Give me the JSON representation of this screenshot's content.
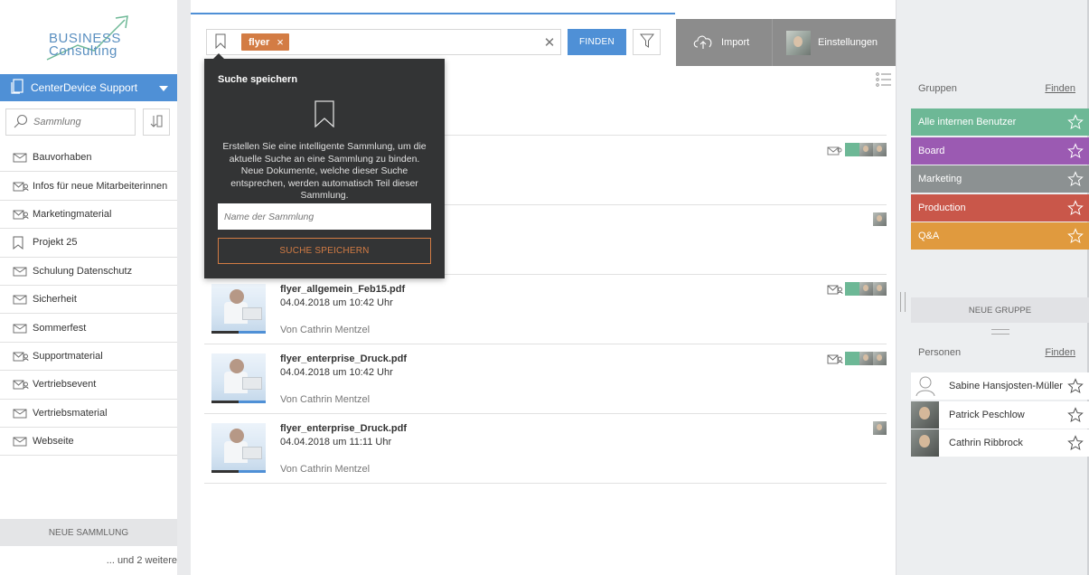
{
  "logo": {
    "line1": "BUSINESS",
    "line2": "Consulting"
  },
  "sidebar": {
    "space_label": "CenterDevice Support",
    "search_placeholder": "Sammlung",
    "items": [
      {
        "label": "Bauvorhaben",
        "icon": "envelope-icon"
      },
      {
        "label": "Infos für neue Mitarbeiterinnen",
        "icon": "shared-envelope-icon"
      },
      {
        "label": "Marketingmaterial",
        "icon": "shared-envelope-icon"
      },
      {
        "label": "Projekt 25",
        "icon": "bookmark-icon"
      },
      {
        "label": "Schulung Datenschutz",
        "icon": "envelope-icon"
      },
      {
        "label": "Sicherheit",
        "icon": "envelope-icon"
      },
      {
        "label": "Sommerfest",
        "icon": "envelope-icon"
      },
      {
        "label": "Supportmaterial",
        "icon": "shared-envelope-icon"
      },
      {
        "label": "Vertriebsevent",
        "icon": "shared-envelope-icon"
      },
      {
        "label": "Vertriebsmaterial",
        "icon": "envelope-icon"
      },
      {
        "label": "Webseite",
        "icon": "envelope-icon"
      }
    ],
    "new_collection": "NEUE SAMMLUNG",
    "more": "... und 2 weitere"
  },
  "search": {
    "tag": "flyer",
    "find_label": "FINDEN"
  },
  "toolbar": {
    "import_label": "Import",
    "settings_label": "Einstellungen"
  },
  "popover": {
    "title": "Suche speichern",
    "description": "Erstellen Sie eine intelligente Sammlung, um die aktuelle Suche an eine Sammlung zu binden. Neue Dokumente, welche dieser Suche entsprechen, werden automatisch Teil dieser Sammlung.",
    "input_placeholder": "Name der Sammlung",
    "save_label": "SUCHE SPEICHERN"
  },
  "documents": [
    {
      "name": "flyer_allgemein_Feb15.pdf",
      "date": "04.04.2018 um 10:42 Uhr",
      "author": "Von Cathrin Mentzel"
    },
    {
      "name": "flyer_enterprise_Druck.pdf",
      "date": "04.04.2018 um 10:42 Uhr",
      "author": "Von Cathrin Mentzel"
    },
    {
      "name": "flyer_enterprise_Druck.pdf",
      "date": "04.04.2018 um 11:11 Uhr",
      "author": "Von Cathrin Mentzel"
    }
  ],
  "groups": {
    "heading": "Gruppen",
    "find": "Finden",
    "items": [
      {
        "label": "Alle internen Benutzer",
        "color": "#6db896"
      },
      {
        "label": "Board",
        "color": "#9b5ab2"
      },
      {
        "label": "Marketing",
        "color": "#8c9192"
      },
      {
        "label": "Production",
        "color": "#c9574a"
      },
      {
        "label": "Q&A",
        "color": "#e09a3e"
      }
    ],
    "new_group": "NEUE GRUPPE"
  },
  "persons": {
    "heading": "Personen",
    "find": "Finden",
    "items": [
      {
        "name": "Sabine Hansjosten-Müller",
        "avatar": "user-outline-icon"
      },
      {
        "name": "Patrick Peschlow",
        "avatar": "photo"
      },
      {
        "name": "Cathrin Ribbrock",
        "avatar": "photo"
      }
    ]
  },
  "colors": {
    "accent": "#4f90d6",
    "orange": "#d37c44",
    "popover_bg": "#333435",
    "toolbar_gray": "#8c8c8c"
  }
}
